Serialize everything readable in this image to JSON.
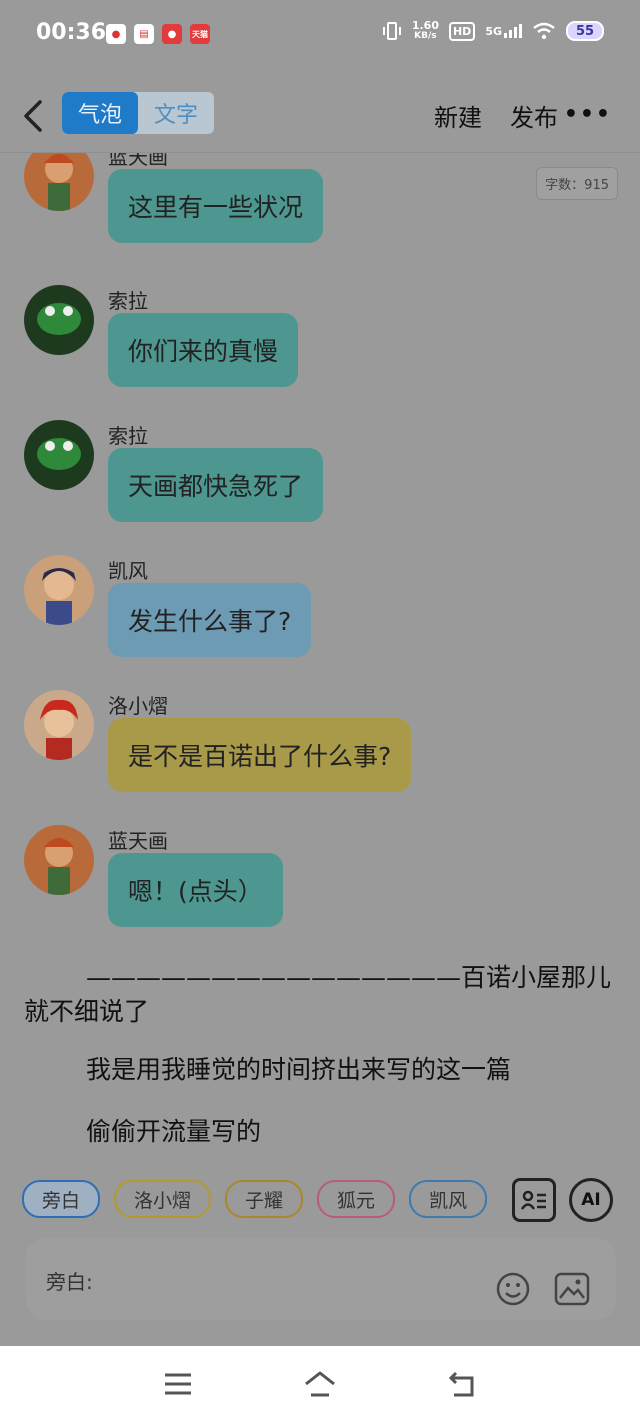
{
  "status": {
    "time": "00:36",
    "net_speed_top": "1.60",
    "net_speed_unit": "KB/s",
    "hd": "HD",
    "network": "5G",
    "battery": "55",
    "apps": [
      "baidu-icon",
      "calendar-icon",
      "taobao-icon",
      "tmall-icon"
    ],
    "tmall_label": "天猫"
  },
  "header": {
    "tab_bubble": "气泡",
    "tab_text": "文字",
    "new_label": "新建",
    "publish_label": "发布",
    "more_label": "•••"
  },
  "word_count": "字数：915",
  "messages": [
    {
      "sender": "蓝天画",
      "text": "这里有一些状况",
      "color": "#4e9790"
    },
    {
      "sender": "索拉",
      "text": "你们来的真慢",
      "color": "#4e9790"
    },
    {
      "sender": "索拉",
      "text": "天画都快急死了",
      "color": "#4e9790"
    },
    {
      "sender": "凯风",
      "text": "发生什么事了?",
      "color": "#6e9bb4"
    },
    {
      "sender": "洛小熠",
      "text": "是不是百诺出了什么事?",
      "color": "#a99a4a"
    },
    {
      "sender": "蓝天画",
      "text": "嗯！(点头）",
      "color": "#4e9790"
    }
  ],
  "narration": [
    "———————————————百诺小屋那儿就不细说了",
    "我是用我睡觉的时间挤出来写的这一篇",
    "偷偷开流量写的"
  ],
  "roles": [
    "旁白",
    "洛小熠",
    "子耀",
    "狐元",
    "凯风"
  ],
  "tools": {
    "ai_label": "AI"
  },
  "input": {
    "label": "旁白:"
  }
}
